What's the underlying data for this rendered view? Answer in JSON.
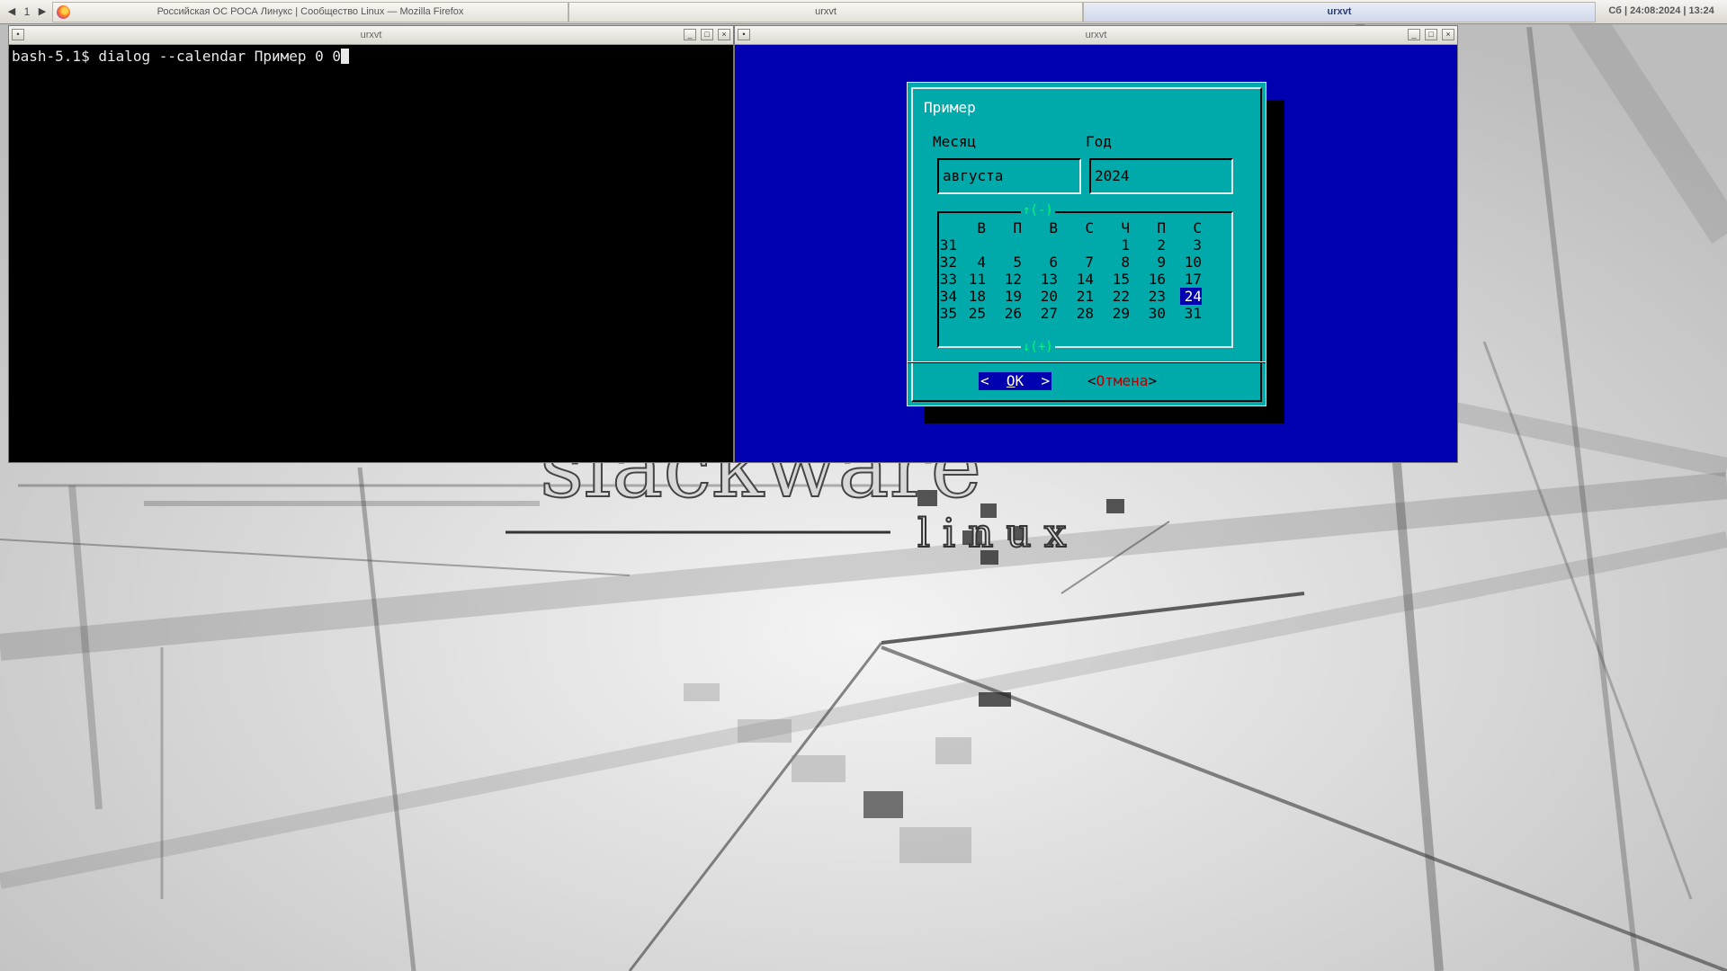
{
  "panel": {
    "pager_prev": "◀",
    "pager_number": "1",
    "pager_next": "▶",
    "tasks": [
      {
        "title": "Российская ОС РОСА Линукс | Сообщество Linux — Mozilla Firefox",
        "icon": "firefox-icon"
      },
      {
        "title": "urxvt"
      },
      {
        "title": "urxvt"
      }
    ],
    "clock": "Сб | 24:08:2024 | 13:24"
  },
  "windows": {
    "left": {
      "title": "urxvt"
    },
    "right": {
      "title": "urxvt"
    }
  },
  "terminal": {
    "command_line": "bash-5.1$ dialog --calendar Пример 0 0"
  },
  "wallpaper": {
    "logo_text": "slackware",
    "logo_sub": "l i n u x"
  },
  "dialog": {
    "title": "Пример",
    "month_label": "Месяц",
    "year_label": "Год",
    "month_value": "августа",
    "year_value": "2024",
    "scroll_up": "↑(-)",
    "scroll_down": "↓(+)",
    "weekdays": [
      "В",
      "П",
      "В",
      "С",
      "Ч",
      "П",
      "С"
    ],
    "weeks": [
      {
        "num": "31",
        "days": [
          "",
          "",
          "",
          "",
          "1",
          "2",
          "3"
        ]
      },
      {
        "num": "32",
        "days": [
          "4",
          "5",
          "6",
          "7",
          "8",
          "9",
          "10"
        ]
      },
      {
        "num": "33",
        "days": [
          "11",
          "12",
          "13",
          "14",
          "15",
          "16",
          "17"
        ]
      },
      {
        "num": "34",
        "days": [
          "18",
          "19",
          "20",
          "21",
          "22",
          "23",
          "24"
        ]
      },
      {
        "num": "35",
        "days": [
          "25",
          "26",
          "27",
          "28",
          "29",
          "30",
          "31"
        ]
      }
    ],
    "selected_day": "24",
    "ok_button": {
      "left": "<",
      "hot": "O",
      "rest": "K",
      "right": ">"
    },
    "cancel_button": {
      "left": "<",
      "label": "Отмена",
      "right": ">"
    }
  },
  "colors": {
    "screen_bg": "#0000b0",
    "dialog_bg": "#00aaaa",
    "arrow": "#00ff66",
    "cancel_hotkey": "#b00000"
  }
}
